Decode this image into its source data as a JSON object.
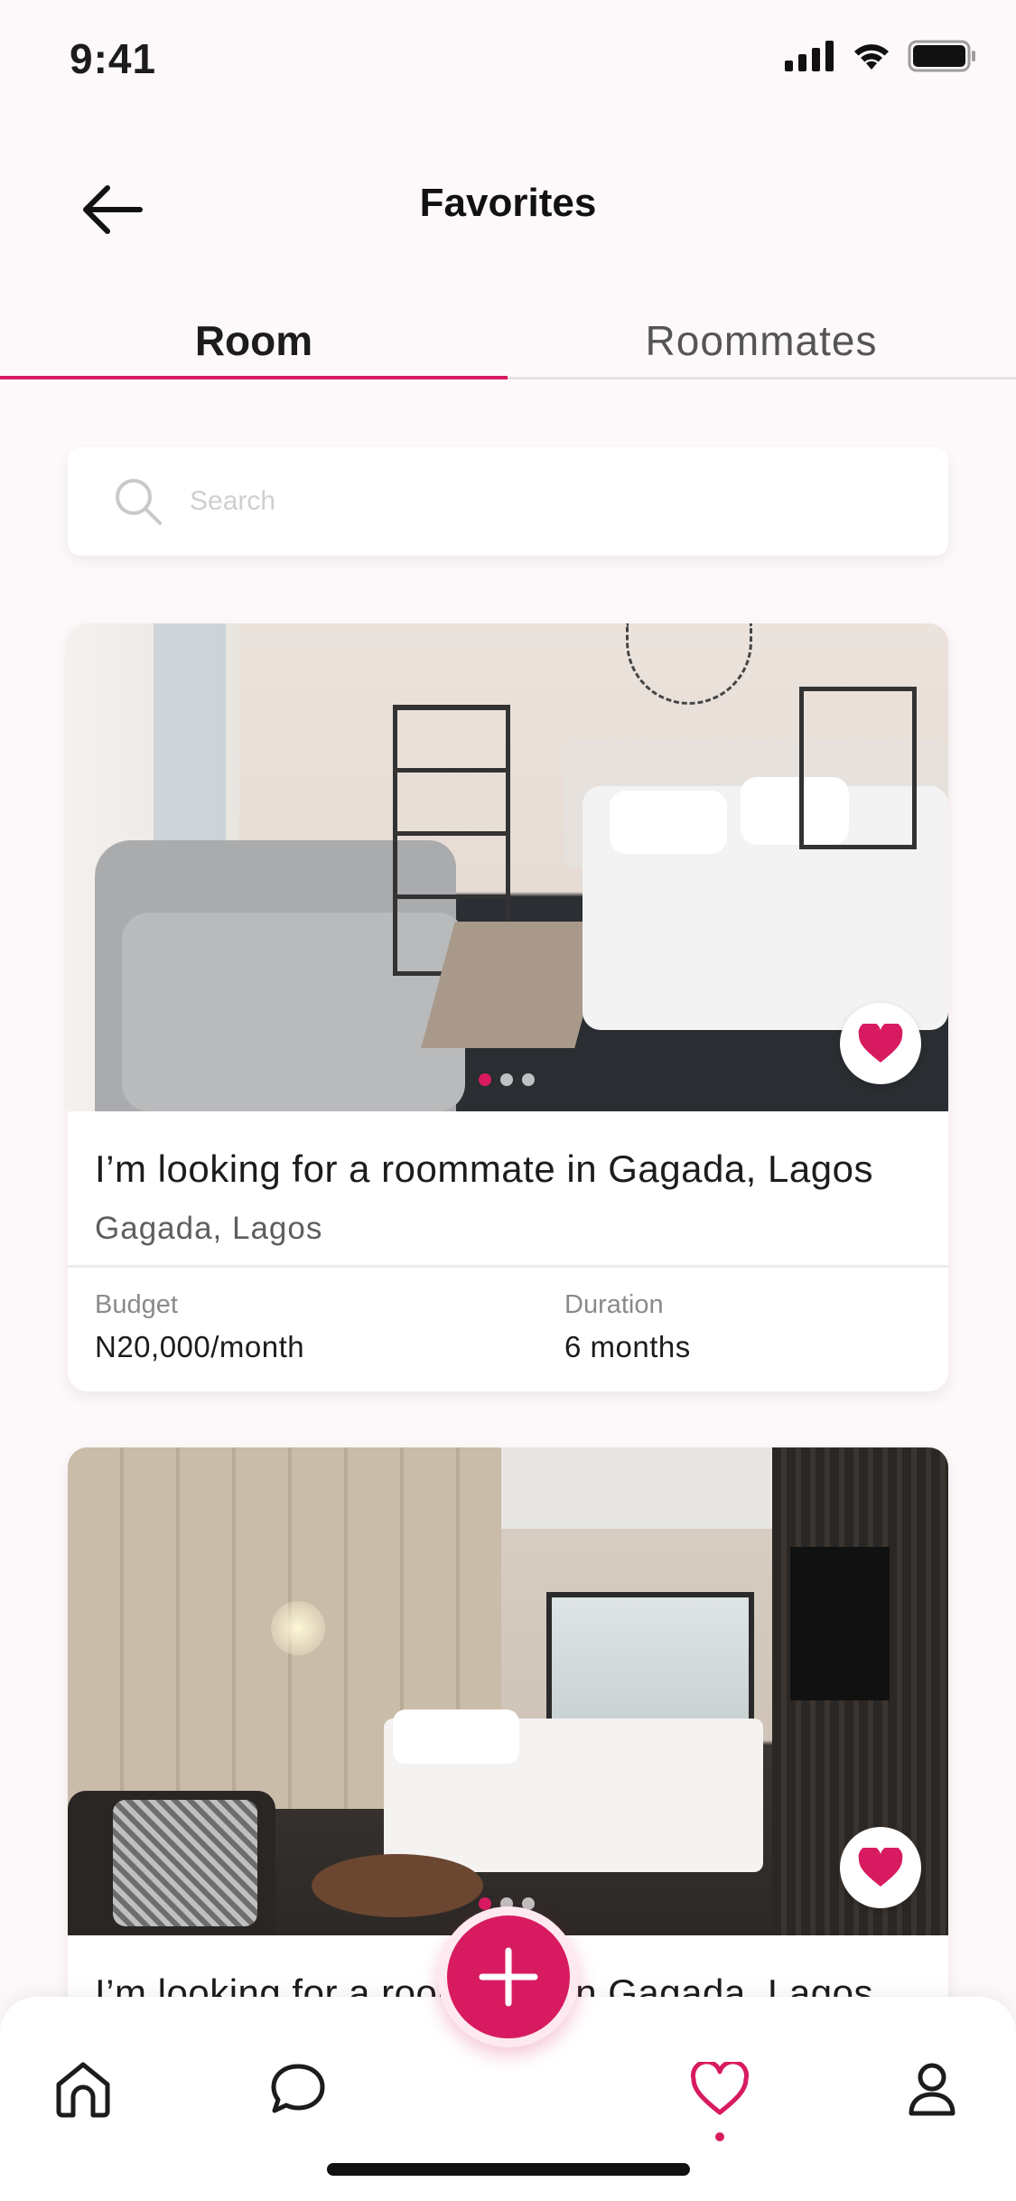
{
  "status_bar": {
    "time": "9:41",
    "icons": [
      "signal-icon",
      "wifi-icon",
      "battery-icon"
    ]
  },
  "header": {
    "title": "Favorites",
    "back_icon": "arrow-left-icon"
  },
  "tabs": [
    {
      "label": "Room",
      "active": true
    },
    {
      "label": "Roommates",
      "active": false
    }
  ],
  "search": {
    "placeholder": "Search",
    "value": ""
  },
  "listings": [
    {
      "title": "I’m looking for a roommate in Gagada, Lagos",
      "location": "Gagada, Lagos",
      "budget_label": "Budget",
      "budget_value": "N20,000/month",
      "duration_label": "Duration",
      "duration_value": "6 months",
      "favorited": true
    },
    {
      "title": "I’m looking for a roommate in Gagada, Lagos",
      "favorited": true
    }
  ],
  "bottom_nav": {
    "items": [
      "home-icon",
      "chat-icon",
      "heart-icon",
      "profile-icon"
    ],
    "active": "heart-icon",
    "fab_icon": "plus-icon"
  },
  "colors": {
    "accent": "#d81b60",
    "background": "#fdf8f9"
  }
}
